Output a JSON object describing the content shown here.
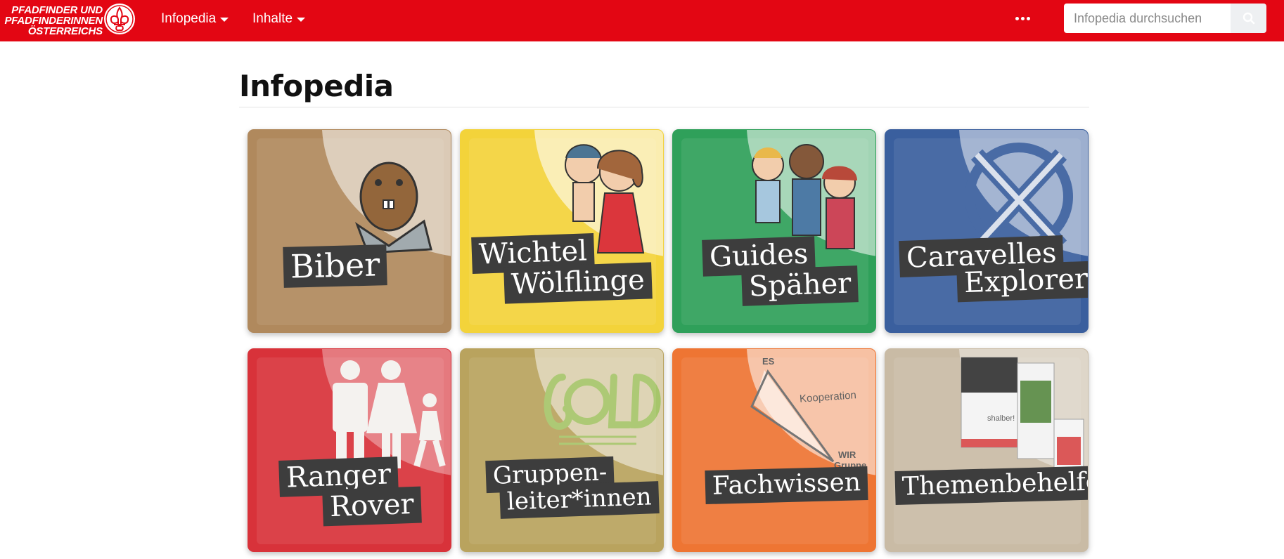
{
  "brand": {
    "line1": "PFADFINDER UND",
    "line2": "PFADFINDERINNEN",
    "line3": "ÖSTERREICHS",
    "logo_icon": "scout-lily-logo-icon"
  },
  "nav": {
    "items": [
      {
        "label": "Infopedia"
      },
      {
        "label": "Inhalte"
      }
    ],
    "more_icon": "ellipsis-icon"
  },
  "search": {
    "placeholder": "Infopedia durchsuchen",
    "button_icon": "search-icon"
  },
  "page": {
    "title": "Infopedia"
  },
  "tiles": [
    {
      "lines": [
        "Biber"
      ],
      "color": "#b0895d",
      "icon": "beaver-illustration-icon"
    },
    {
      "lines": [
        "Wichtel",
        "Wölflinge"
      ],
      "color": "#f3d33a",
      "icon": "children-dancing-illustration-icon"
    },
    {
      "lines": [
        "Guides",
        "Späher"
      ],
      "color": "#2fa05a",
      "icon": "scouts-group-illustration-icon"
    },
    {
      "lines": [
        "Caravelles",
        "Explorer"
      ],
      "color": "#3a5f9e",
      "icon": "explorer-cross-emblem-icon"
    },
    {
      "lines": [
        "Ranger",
        "Rover"
      ],
      "color": "#d8323a",
      "icon": "ranger-rover-figures-icon"
    },
    {
      "lines": [
        "Gruppen-",
        "leiter*innen"
      ],
      "color": "#b9a35e",
      "icon": "gold-handbook-icon"
    },
    {
      "lines": [
        "Fachwissen"
      ],
      "color": "#ee7533",
      "icon": "triangle-diagram-icon",
      "diagram": {
        "top": "ES",
        "right": "Kooperation",
        "bottom1": "WIR",
        "bottom2": "Gruppe"
      }
    },
    {
      "lines": [
        "Themenbehelfe"
      ],
      "color": "#c9bba5",
      "icon": "brochures-stack-icon",
      "brochure_text": "shalber!"
    }
  ]
}
